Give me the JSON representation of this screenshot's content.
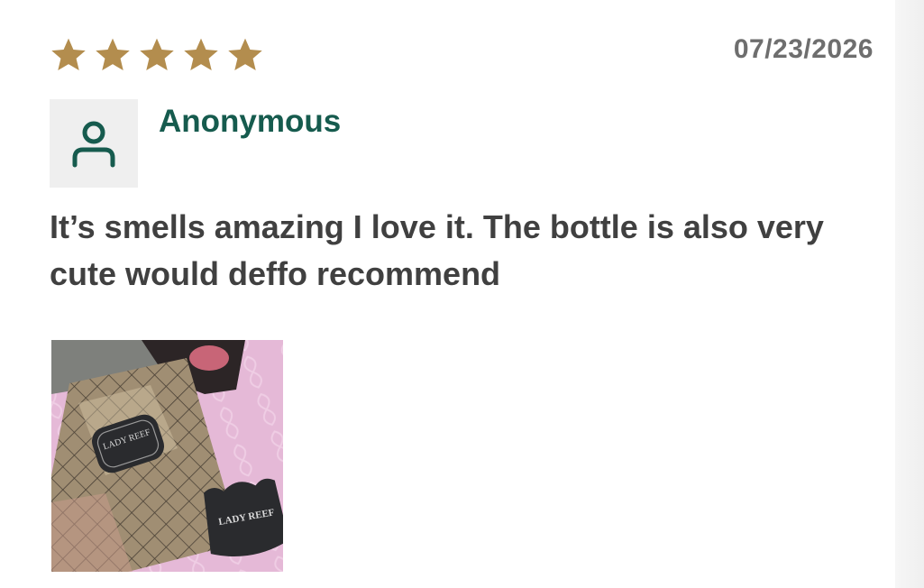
{
  "review": {
    "rating": 5,
    "rating_max": 5,
    "star_color": "#b38d4e",
    "star_icon": "star-icon",
    "date": "07/23/2026",
    "author": "Anonymous",
    "author_color": "#165b4e",
    "avatar_icon": "user-icon",
    "text": "It’s smells amazing I love it. The bottle is also very cute would deffo recommend",
    "photo": {
      "label_1": "LADY REEF",
      "label_2": "LADY REEF"
    }
  }
}
